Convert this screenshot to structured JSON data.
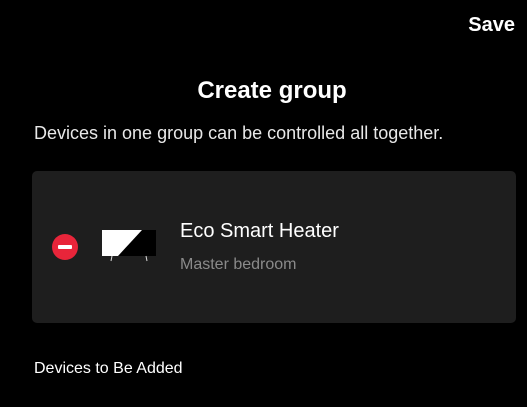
{
  "header": {
    "save_label": "Save"
  },
  "page": {
    "title": "Create group",
    "subtitle": "Devices in one group can be controlled all together."
  },
  "group_devices": [
    {
      "name": "Eco Smart Heater",
      "room": "Master bedroom",
      "icon": "heater-icon"
    }
  ],
  "sections": {
    "to_add_label": "Devices to Be Added"
  },
  "colors": {
    "background": "#000000",
    "card": "#1e1e1e",
    "remove": "#e8253a",
    "secondary_text": "#8a8a8a"
  }
}
